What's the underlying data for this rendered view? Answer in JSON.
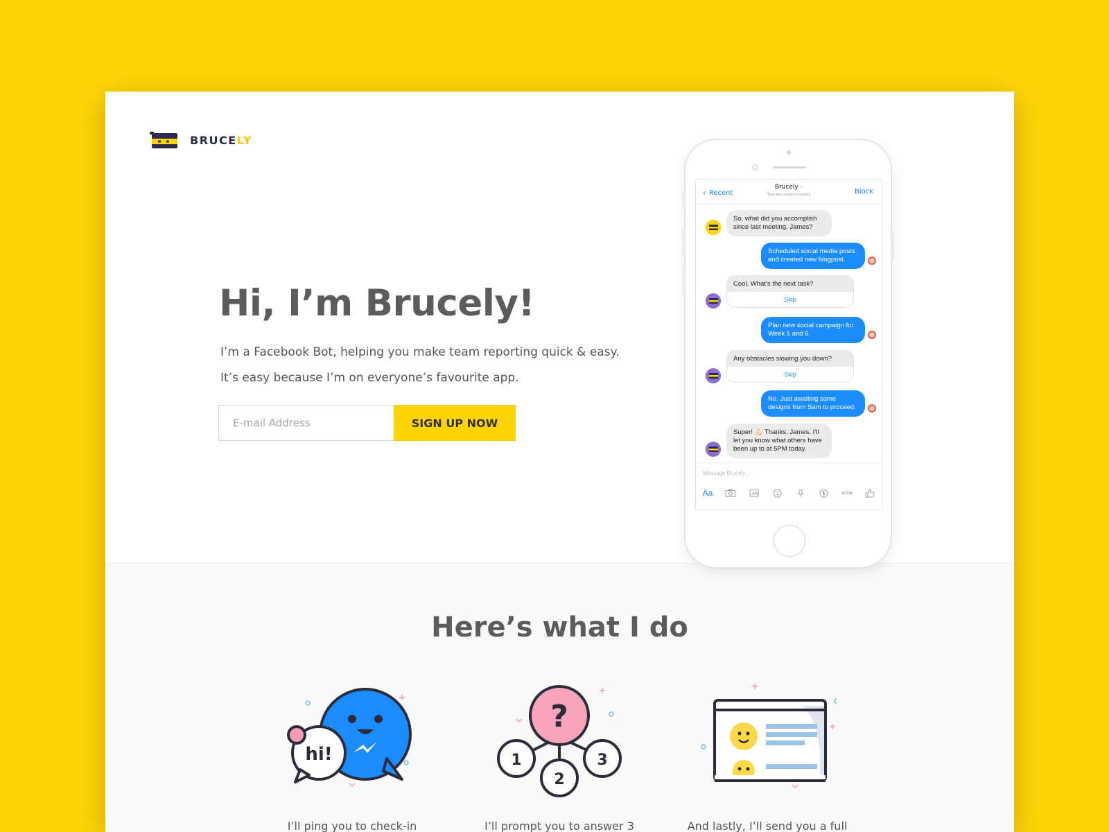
{
  "brand": {
    "name_main": "BRUCE",
    "name_accent": "LY",
    "accent_color": "#FFC800",
    "background_color": "#FFD407"
  },
  "hero": {
    "title": "Hi, I’m Brucely!",
    "subtitle_1": "I’m a Facebook Bot, helping you make team reporting quick & easy.",
    "subtitle_2": "It’s easy because I’m on everyone’s favourite app.",
    "email_placeholder": "E-mail Address",
    "signup_label": "SIGN UP NOW"
  },
  "messenger": {
    "back_label": "Recent",
    "contact_name": "Brucely",
    "contact_status": "Typically replies instantly",
    "block_label": "Block",
    "messages": [
      {
        "from": "bot",
        "text": "So, what did you accomplish since last meeting, James?"
      },
      {
        "from": "user",
        "text": "Scheduled social media posts and created new blogpost."
      },
      {
        "from": "bot",
        "text": "Cool. What’s the next task?",
        "action": "Skip"
      },
      {
        "from": "user",
        "text": "Plan new social campaign for Week 5 and 6."
      },
      {
        "from": "bot",
        "text": "Any obstacles slowing you down?",
        "action": "Skip"
      },
      {
        "from": "user",
        "text": "No. Just awaiting some designs from Sam to proceed."
      },
      {
        "from": "bot",
        "text": "Super! 💪🏻 Thanks, James. I’ll let you know what others have been up to at 5PM today."
      }
    ],
    "composer_placeholder": "Message Brucely…",
    "composer_aa": "Aa"
  },
  "features": {
    "title": "Here’s what I do",
    "items": [
      {
        "icon": "messenger-hi-icon",
        "bubble_text": "hi!",
        "text": "I’ll ping you to check-in"
      },
      {
        "icon": "questions-icon",
        "badge_q": "?",
        "nodes": [
          "1",
          "2",
          "3"
        ],
        "text": "I’ll prompt you to answer 3"
      },
      {
        "icon": "report-card-icon",
        "text": "And lastly, I’ll send you a full"
      }
    ]
  }
}
